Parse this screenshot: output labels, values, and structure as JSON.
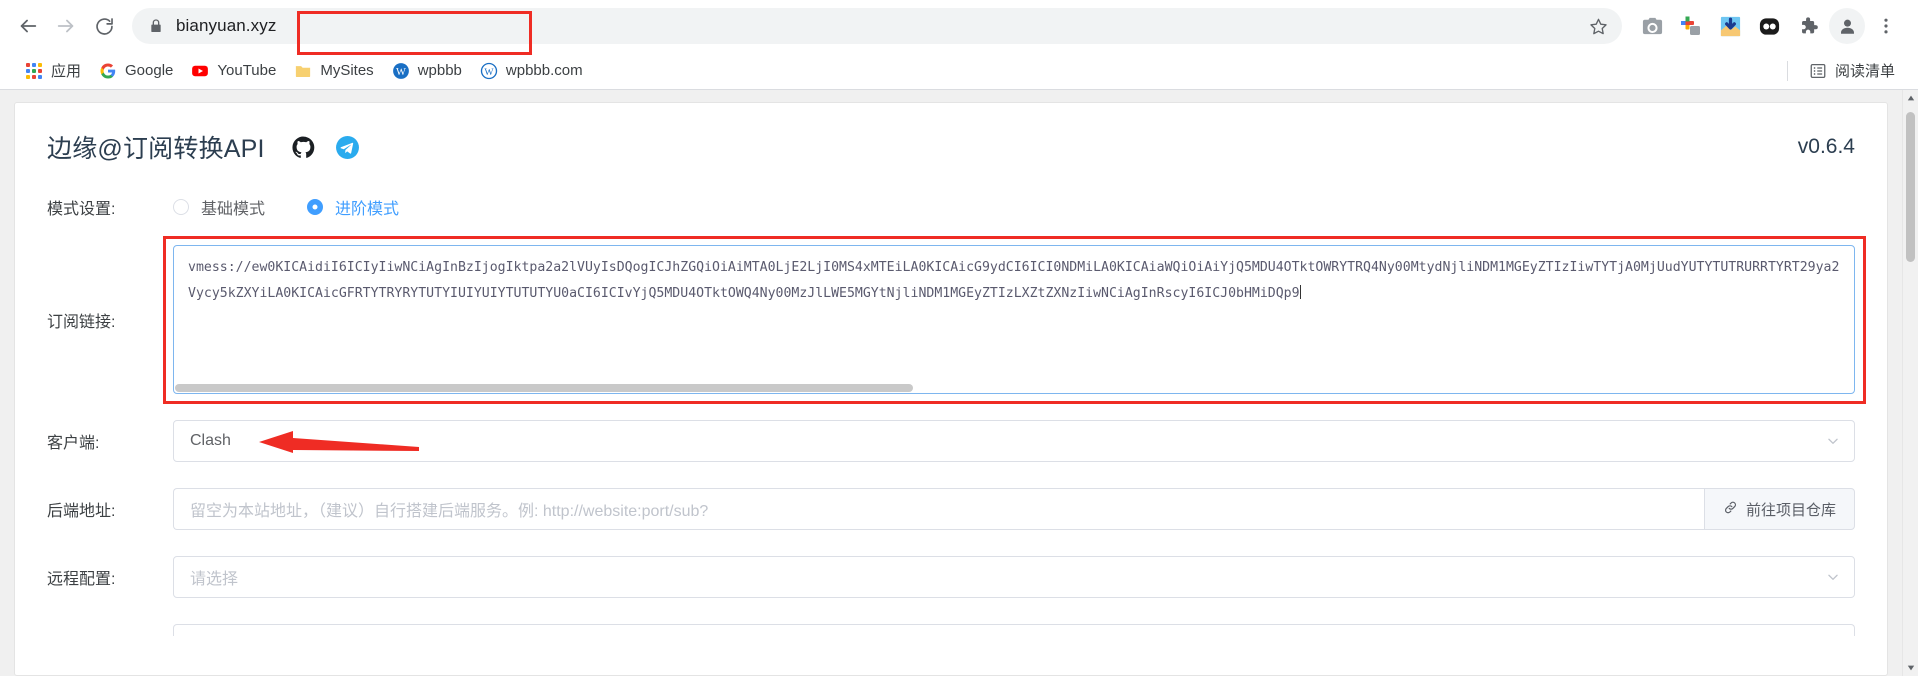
{
  "browser": {
    "nav": {
      "back_label": "Back",
      "forward_label": "Forward",
      "reload_label": "Reload"
    },
    "omnibox": {
      "url": "bianyuan.xyz",
      "lock_icon": "lock-icon",
      "star_icon": "star-icon",
      "highlighted": true,
      "highlight_color": "#ef2c24"
    },
    "extensions": [
      {
        "name": "camera-icon",
        "label": "Screenshot"
      },
      {
        "name": "colorful-plus-icon",
        "label": "Add extension"
      },
      {
        "name": "download-manager-icon",
        "label": "Download"
      },
      {
        "name": "panda-icon",
        "label": "Extension"
      },
      {
        "name": "puzzle-icon",
        "label": "Extensions"
      },
      {
        "name": "profile-avatar-icon",
        "label": "Profile"
      },
      {
        "name": "three-dot-menu-icon",
        "label": "Customize and control"
      }
    ],
    "bookmarks": [
      {
        "label": "应用",
        "icon": "apps-grid-icon"
      },
      {
        "label": "Google",
        "icon": "google-icon"
      },
      {
        "label": "YouTube",
        "icon": "youtube-icon"
      },
      {
        "label": "MySites",
        "icon": "folder-icon"
      },
      {
        "label": "wpbbb",
        "icon": "wordpress-blue-icon"
      },
      {
        "label": "wpbbb.com",
        "icon": "wordpress-outline-icon"
      }
    ],
    "reading_list": {
      "label": "阅读清单",
      "icon": "reading-list-icon"
    }
  },
  "page": {
    "header": {
      "title": "边缘@订阅转换API",
      "github_icon": "github-icon",
      "telegram_icon": "telegram-icon",
      "version": "v0.6.4"
    },
    "fields": {
      "mode": {
        "label": "模式设置:",
        "options": [
          {
            "label": "基础模式",
            "selected": false
          },
          {
            "label": "进阶模式",
            "selected": true
          }
        ]
      },
      "subscription": {
        "label": "订阅链接:",
        "value": "vmess://ew0KICAidiI6ICIyIiwNCiAgInBzIjogIktpa2a2lVUyIsDQogICJhZGQiOiAiMTA0LjE2LjI0MS4xMTEiLA0KICAicG9ydCI6ICI0NDMiLA0KICAiaWQiOiAiYjQ5MDU4OTktOWRYTRQ4Ny00MtydNjliNDM1MGEyZTIzIiwTYTjA0MjUudYUTYTUTRURRTYRT29ya2Vycy5kZXYiLA0KICAicGFRTYTRYRYTUTYIUIYUIYTUTUTYU0aCI6ICIvYjQ5MDU4OTktOWQ4Ny00MzJlLWE5MGYtNjliNDM1MGEyZTIzLXZtZXNzIiwNCiAgInRscyI6ICJ0bHMiDQp9",
        "highlighted": true,
        "highlight_color": "#ef2c24"
      },
      "client": {
        "label": "客户端:",
        "value": "Clash",
        "chevron_icon": "chevron-down-icon",
        "annotation": "red-arrow"
      },
      "backend": {
        "label": "后端地址:",
        "value": "",
        "placeholder": "留空为本站地址，（建议）自行搭建后端服务。例: http://website:port/sub?",
        "append_button": {
          "label": "前往项目仓库",
          "icon": "link-icon"
        }
      },
      "remote_config": {
        "label": "远程配置:",
        "value": "",
        "placeholder": "请选择",
        "chevron_icon": "chevron-down-icon"
      }
    }
  },
  "colors": {
    "accent_blue": "#409eff",
    "highlight_red": "#ef2c24",
    "title_navy": "#2c3e50",
    "border_grey": "#dcdfe6",
    "placeholder_grey": "#c0c4cc"
  }
}
